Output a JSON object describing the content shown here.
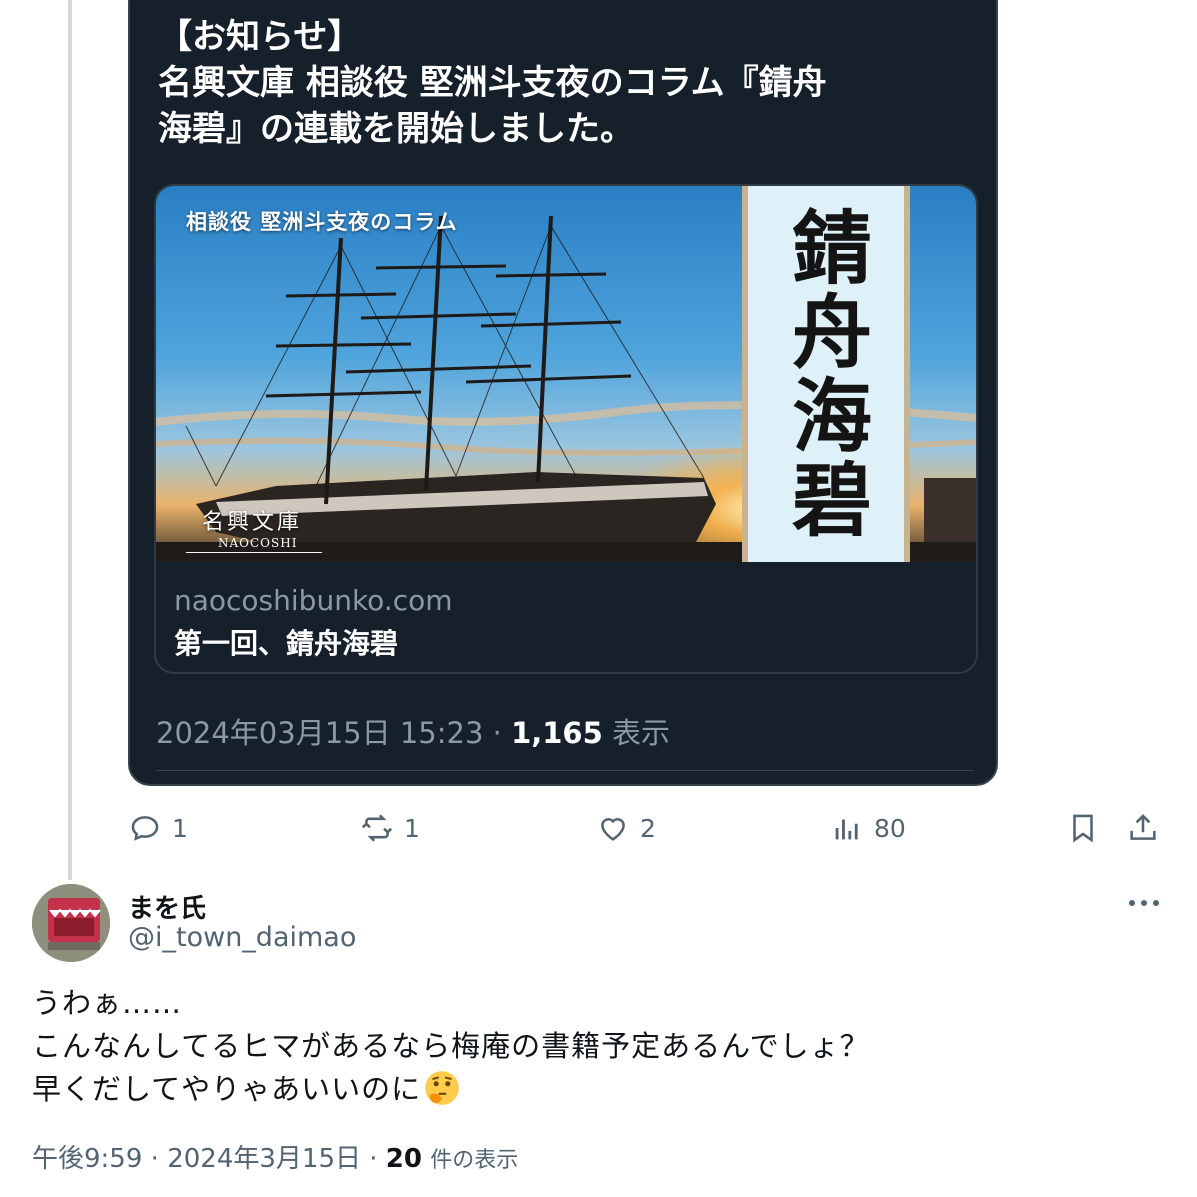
{
  "quoted_tweet": {
    "text_line1": "【お知らせ】",
    "text_line2": "名興文庫 相談役 堅洲斗支夜のコラム『錆舟",
    "text_line3": "海碧』の連載を開始しました。",
    "link_card": {
      "image_caption": "相談役 堅洲斗支夜のコラム",
      "image_title": "錆舟海碧",
      "image_logo": "名興文庫",
      "image_logo_sub": "NAOCOSHI",
      "domain": "naocoshibunko.com",
      "title": "第一回、錆舟海碧"
    },
    "timestamp": "2024年03月15日 15:23",
    "views_count": "1,165",
    "views_label": "表示"
  },
  "actions": {
    "reply_count": "1",
    "retweet_count": "1",
    "like_count": "2",
    "views_count": "80"
  },
  "reply": {
    "author_name": "まを氏",
    "author_handle": "@i_town_daimao",
    "line1": "うわぁ……",
    "line2": "こんなんしてるヒマがあるなら梅庵の書籍予定あるんでしょ？",
    "line3": "早くだしてやりゃあいいのに",
    "emoji": "thinking-face",
    "time": "午後9:59",
    "date": "2024年3月15日",
    "views_count": "20",
    "views_label": "件の表示"
  },
  "colors": {
    "card_background": "#15202b",
    "secondary_text": "#536471",
    "dark_secondary_text": "#8b98a5",
    "thread_line": "#cfd9de"
  }
}
